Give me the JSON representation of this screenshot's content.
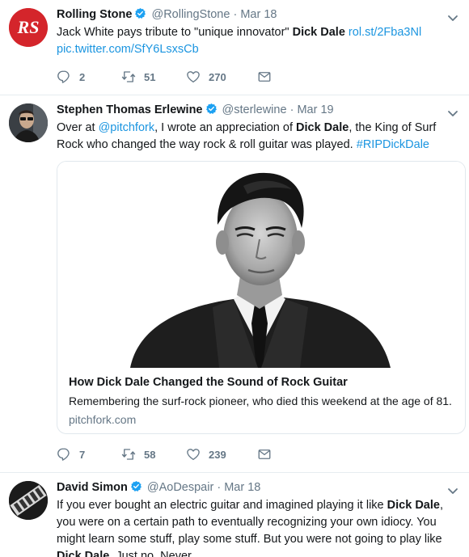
{
  "tweets": [
    {
      "name": "Rolling Stone",
      "handle": "@RollingStone",
      "separator": "·",
      "date": "Mar 18",
      "text_1": "Jack White pays tribute to \"unique innovator\" ",
      "text_bold_1": "Dick Dale",
      "text_2": " ",
      "link_1": "rol.st/2Fba3Nl",
      "link_2": "pic.twitter.com/SfY6LsxsCb",
      "replies": "2",
      "retweets": "51",
      "likes": "270",
      "avatar_text": "RS"
    },
    {
      "name": "Stephen Thomas Erlewine",
      "handle": "@sterlewine",
      "separator": "·",
      "date": "Mar 19",
      "text_1": "Over at ",
      "mention": "@pitchfork",
      "text_2": ", I wrote an appreciation of ",
      "text_bold_1": "Dick Dale",
      "text_3": ", the King of Surf Rock who changed the way rock & roll guitar was played. ",
      "hashtag": "#RIPDickDale",
      "card": {
        "title": "How Dick Dale Changed the Sound of Rock Guitar",
        "description": "Remembering the surf-rock pioneer, who died this weekend at the age of 81.",
        "domain": "pitchfork.com"
      },
      "replies": "7",
      "retweets": "58",
      "likes": "239"
    },
    {
      "name": "David Simon",
      "handle": "@AoDespair",
      "separator": "·",
      "date": "Mar 18",
      "text_1": "If you ever bought an electric guitar and imagined playing it like ",
      "text_bold_1": "Dick Dale",
      "text_2": ", you were on a certain path to eventually recognizing your own idiocy. You might learn some stuff, play some stuff. But you were not going to play like ",
      "text_bold_2": "Dick Dale",
      "text_3": ". Just no. Never."
    }
  ],
  "colors": {
    "link": "#1b95e0",
    "muted": "#657786",
    "text": "#14171a",
    "border": "#e6ecf0",
    "verified": "#1da1f2",
    "rs_red": "#d4252b"
  },
  "icons": [
    "chevron-down-icon",
    "verified-badge-icon",
    "reply-icon",
    "retweet-icon",
    "like-icon",
    "direct-message-icon"
  ]
}
